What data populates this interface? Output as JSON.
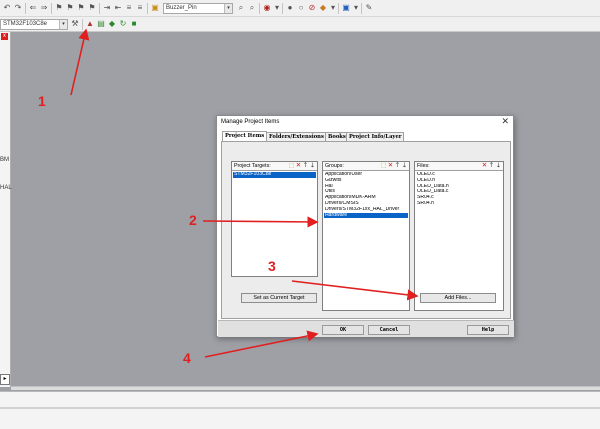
{
  "toolbar2": {
    "target_select": "STM32F103C8e"
  },
  "toolbar1": {
    "find_select": "Buzzer_Pin"
  },
  "left_panel": {
    "label_a": "BM",
    "label_b": "HAL"
  },
  "dialog": {
    "title": "Manage Project Items",
    "close_glyph": "✕",
    "tabs": [
      {
        "label": "Project Items"
      },
      {
        "label": "Folders/Extensions"
      },
      {
        "label": "Books"
      },
      {
        "label": "Project Info/Layer"
      }
    ],
    "targets": {
      "header": "Project Targets:",
      "items": [
        "STM32F103C8e"
      ],
      "selected": 0
    },
    "groups": {
      "header": "Groups:",
      "items": [
        "Application/User",
        "Gizwits",
        "Hal",
        "Utils",
        "Application/MDK-ARM",
        "Drivers/CMSIS",
        "Drivers/STM32F1xx_HAL_Driver",
        "Hardware"
      ],
      "selected": 7
    },
    "files": {
      "header": "Files:",
      "items": [
        "OLED.c",
        "OLED.h",
        "OLED_Data.h",
        "OLED_Data.c",
        "SR04.c",
        "SR04.h"
      ]
    },
    "list_buttons": {
      "new": "⬚",
      "delete": "✕",
      "up": "🡑",
      "down": "🡓"
    },
    "set_target_label": "Set as Current Target",
    "add_files_label": "Add Files...",
    "ok_label": "OK",
    "cancel_label": "Cancel",
    "help_label": "Help"
  },
  "annotations": {
    "n1": "1",
    "n2": "2",
    "n3": "3",
    "n4": "4",
    "color": "#e02020"
  }
}
